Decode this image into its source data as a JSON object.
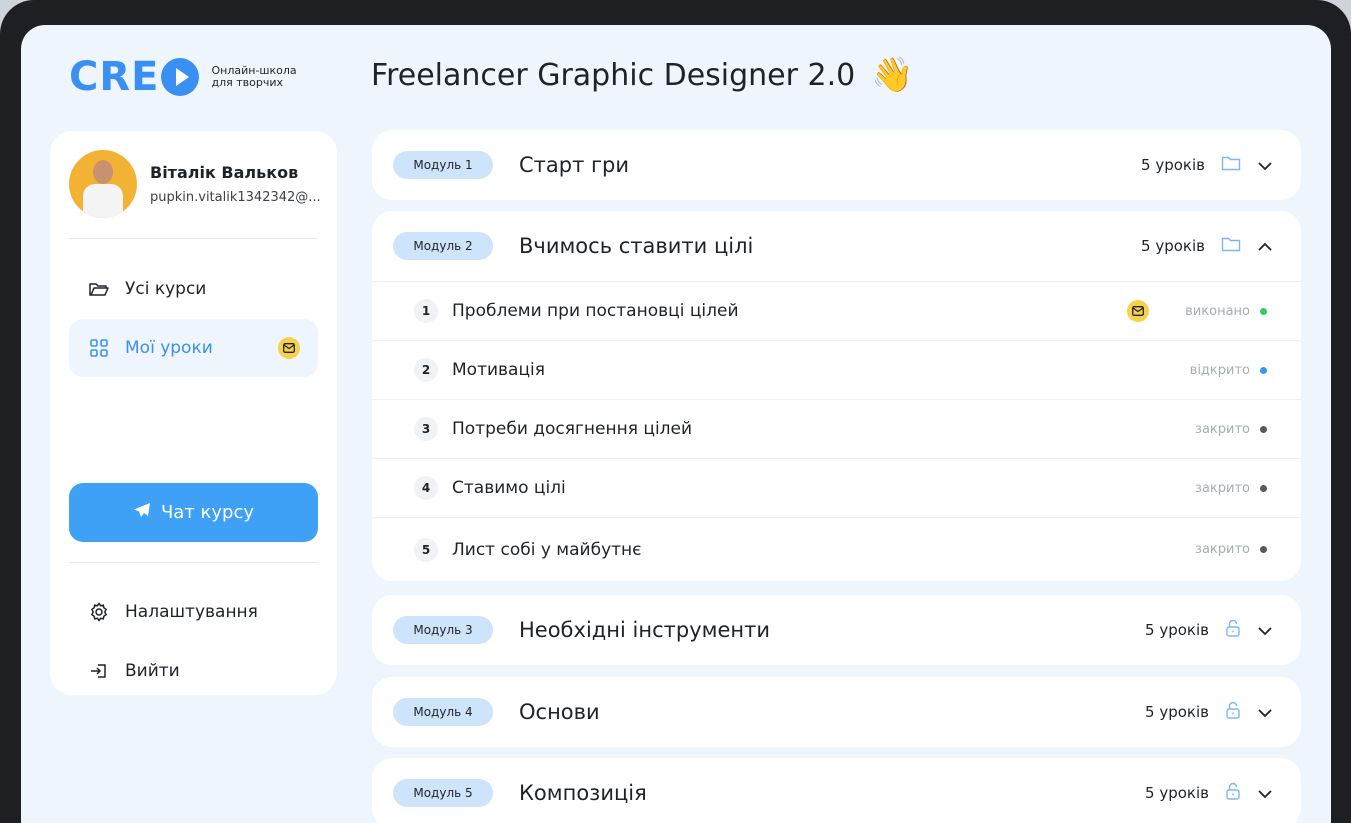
{
  "brand": {
    "logo_text": "CRE",
    "tagline_line1": "Онлайн-школа",
    "tagline_line2": "для творчих",
    "accent": "#3a8ff2"
  },
  "page": {
    "title": "Freelancer Graphic Designer 2.0",
    "emoji": "👋"
  },
  "user": {
    "name": "Віталік Вальков",
    "email": "pupkin.vitalik1342342@..."
  },
  "nav": {
    "all_courses": "Усі курси",
    "my_lessons": "Мої уроки",
    "chat": "Чат курсу",
    "settings": "Налаштування",
    "logout": "Вийти"
  },
  "modules": [
    {
      "badge": "Модуль 1",
      "title": "Старт гри",
      "count": "5 уроків",
      "icon": "folder-icon",
      "expanded": false
    },
    {
      "badge": "Модуль 2",
      "title": "Вчимось ставити цілі",
      "count": "5 уроків",
      "icon": "folder-icon",
      "expanded": true,
      "lessons": [
        {
          "num": "1",
          "title": "Проблеми при постановці цілей",
          "status": "виконано",
          "status_color": "#2fcf5b",
          "has_mail": true
        },
        {
          "num": "2",
          "title": "Мотивація",
          "status": "відкрито",
          "status_color": "#3a98f0",
          "has_mail": false
        },
        {
          "num": "3",
          "title": "Потреби досягнення цілей",
          "status": "закрито",
          "status_color": "#555a61",
          "has_mail": false
        },
        {
          "num": "4",
          "title": "Ставимо цілі",
          "status": "закрито",
          "status_color": "#555a61",
          "has_mail": false
        },
        {
          "num": "5",
          "title": "Лист собі у майбутнє",
          "status": "закрито",
          "status_color": "#555a61",
          "has_mail": false
        }
      ]
    },
    {
      "badge": "Модуль 3",
      "title": "Необхідні інструменти",
      "count": "5 уроків",
      "icon": "lock-icon",
      "expanded": false
    },
    {
      "badge": "Модуль 4",
      "title": "Основи",
      "count": "5 уроків",
      "icon": "lock-icon",
      "expanded": false
    },
    {
      "badge": "Модуль 5",
      "title": "Композиція",
      "count": "5 уроків",
      "icon": "lock-icon",
      "expanded": false
    }
  ]
}
